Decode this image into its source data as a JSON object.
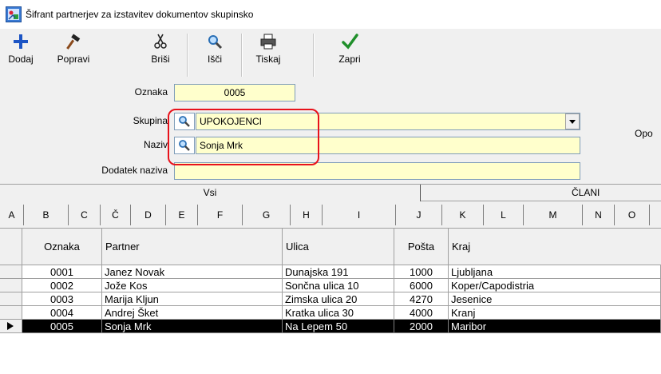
{
  "window": {
    "title": "Šifrant partnerjev za izstavitev dokumentov skupinsko"
  },
  "toolbar": {
    "dodaj": "Dodaj",
    "popravi": "Popravi",
    "brisi": "Briši",
    "isci": "Išči",
    "tiskaj": "Tiskaj",
    "zapri": "Zapri"
  },
  "form": {
    "oznaka_label": "Oznaka",
    "oznaka_value": "0005",
    "skupina_label": "Skupina",
    "skupina_value": "UPOKOJENCI",
    "naziv_label": "Naziv",
    "naziv_value": "Sonja Mrk",
    "dodatek_label": "Dodatek naziva",
    "dodatek_value": "",
    "right_label": "Opo"
  },
  "tabs_top": [
    "Vsi",
    "ČLANI"
  ],
  "tabs_letters": [
    "A",
    "B",
    "C",
    "Č",
    "D",
    "E",
    "F",
    "G",
    "H",
    "I",
    "J",
    "K",
    "L",
    "M",
    "N",
    "O"
  ],
  "grid": {
    "columns": [
      "Oznaka",
      "Partner",
      "Ulica",
      "Pošta",
      "Kraj"
    ],
    "rows": [
      {
        "oznaka": "0001",
        "partner": "Janez Novak",
        "ulica": "Dunajska 191",
        "posta": "1000",
        "kraj": "Ljubljana"
      },
      {
        "oznaka": "0002",
        "partner": "Jože Kos",
        "ulica": "Sončna ulica 10",
        "posta": "6000",
        "kraj": "Koper/Capodistria"
      },
      {
        "oznaka": "0003",
        "partner": "Marija Kljun",
        "ulica": "Zimska ulica 20",
        "posta": "4270",
        "kraj": "Jesenice"
      },
      {
        "oznaka": "0004",
        "partner": "Andrej Šket",
        "ulica": "Kratka ulica 30",
        "posta": "4000",
        "kraj": "Kranj"
      },
      {
        "oznaka": "0005",
        "partner": "Sonja Mrk",
        "ulica": "Na Lepem 50",
        "posta": "2000",
        "kraj": "Maribor"
      }
    ],
    "selected_index": 4
  },
  "colors": {
    "field_bg": "#ffffcc",
    "highlight": "#e8121b",
    "selected_row": "#000000"
  },
  "icons": [
    "app-icon",
    "plus-icon",
    "hammer-icon",
    "scissors-icon",
    "magnifier-icon",
    "printer-icon",
    "checkmark-icon"
  ]
}
